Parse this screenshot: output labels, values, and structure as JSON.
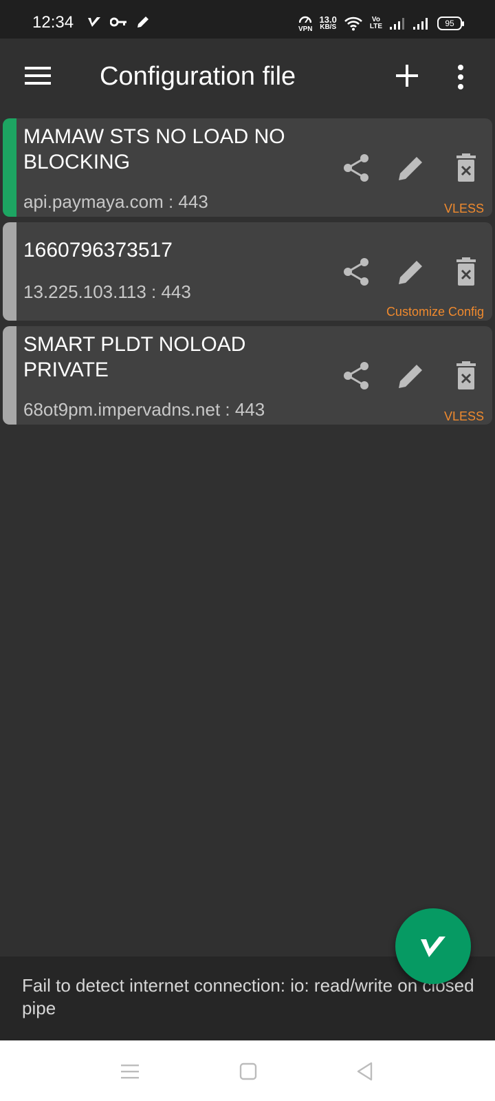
{
  "status_bar": {
    "time": "12:34",
    "vpn_label": "VPN",
    "speed_value": "13.0",
    "speed_unit": "KB/S",
    "volte_top": "Vo",
    "volte_bottom": "LTE",
    "battery": "95"
  },
  "toolbar": {
    "title": "Configuration file",
    "menu_icon": "hamburger-menu-icon",
    "add_icon": "plus-icon",
    "more_icon": "more-vert-icon"
  },
  "configs": [
    {
      "name": "MAMAW STS NO LOAD NO BLOCKING",
      "address": "api.paymaya.com : 443",
      "type": "VLESS",
      "selected": true
    },
    {
      "name": "1660796373517",
      "address": "13.225.103.113 : 443",
      "type": "Customize Config",
      "selected": false
    },
    {
      "name": "SMART PLDT NOLOAD PRIVATE",
      "address": "68ot9pm.impervadns.net : 443",
      "type": "VLESS",
      "selected": false
    }
  ],
  "colors": {
    "accent_selected": "#1da562",
    "accent_unselected": "#a8a8a8",
    "tag": "#f08a2e",
    "fab": "#069a63"
  },
  "status_message": "Fail to detect internet connection:  io: read/write on closed pipe",
  "nav_bar": {
    "recents_icon": "recents-icon",
    "home_icon": "home-icon",
    "back_icon": "back-icon"
  }
}
